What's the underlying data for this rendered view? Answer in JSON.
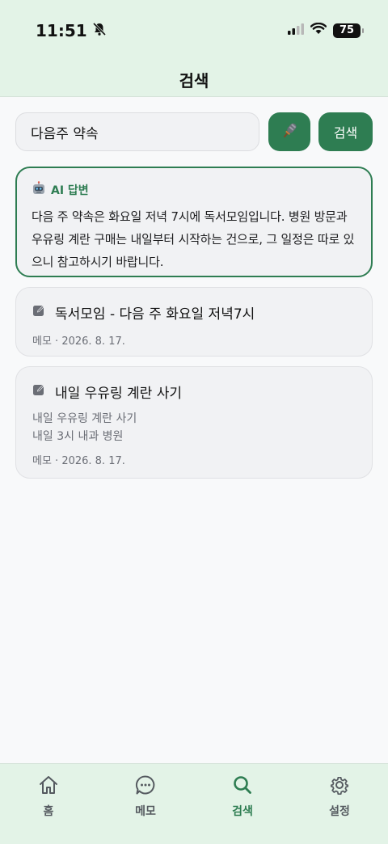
{
  "status_bar": {
    "time": "11:51",
    "battery": "75"
  },
  "header": {
    "title": "검색"
  },
  "search": {
    "value": "다음주 약속",
    "button_label": "검색"
  },
  "ai_answer": {
    "heading": "AI 답변",
    "text": "다음 주 약속은 화요일 저녁 7시에 독서모임입니다. 병원 방문과 우유링 계란 구매는 내일부터 시작하는 건으로, 그 일정은 따로 있으니 참고하시기 바랍니다."
  },
  "results": [
    {
      "title": "독서모임 - 다음 주 화요일 저녁7시",
      "lines": [],
      "meta": "메모 · 2026. 8. 17."
    },
    {
      "title": "내일 우유링 계란 사기",
      "lines": [
        "내일 우유링 계란 사기",
        "내일 3시 내과 병원"
      ],
      "meta": "메모 · 2026. 8. 17."
    }
  ],
  "bottom_nav": {
    "items": [
      {
        "label": "홈",
        "icon": "home-icon",
        "active": false
      },
      {
        "label": "메모",
        "icon": "chat-bubble-icon",
        "active": false
      },
      {
        "label": "검색",
        "icon": "search-icon",
        "active": true
      },
      {
        "label": "설정",
        "icon": "gear-icon",
        "active": false
      }
    ]
  },
  "colors": {
    "accent": "#2e7d52",
    "header_bg": "#e3f3e7",
    "card_bg": "#f1f2f4"
  }
}
